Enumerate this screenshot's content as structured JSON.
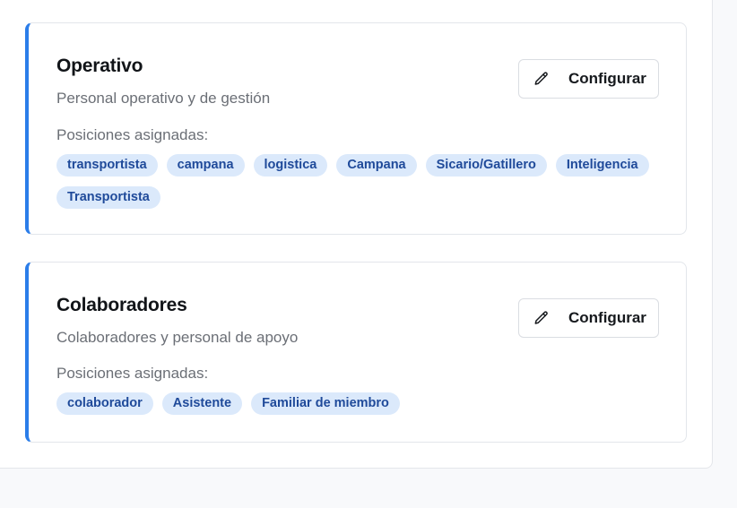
{
  "groups": [
    {
      "title": "Operativo",
      "description": "Personal operativo y de gestión",
      "positions_label": "Posiciones asignadas:",
      "configure_label": "Configurar",
      "positions": [
        "transportista",
        "campana",
        "logistica",
        "Campana",
        "Sicario/Gatillero",
        "Inteligencia",
        "Transportista"
      ]
    },
    {
      "title": "Colaboradores",
      "description": "Colaboradores y personal de apoyo",
      "positions_label": "Posiciones asignadas:",
      "configure_label": "Configurar",
      "positions": [
        "colaborador",
        "Asistente",
        "Familiar de miembro"
      ]
    }
  ],
  "colors": {
    "accent": "#2b7de9",
    "tag_background": "#dbe9fb",
    "tag_text": "#1f4a9a"
  },
  "icons": {
    "configure": "pencil-icon"
  }
}
